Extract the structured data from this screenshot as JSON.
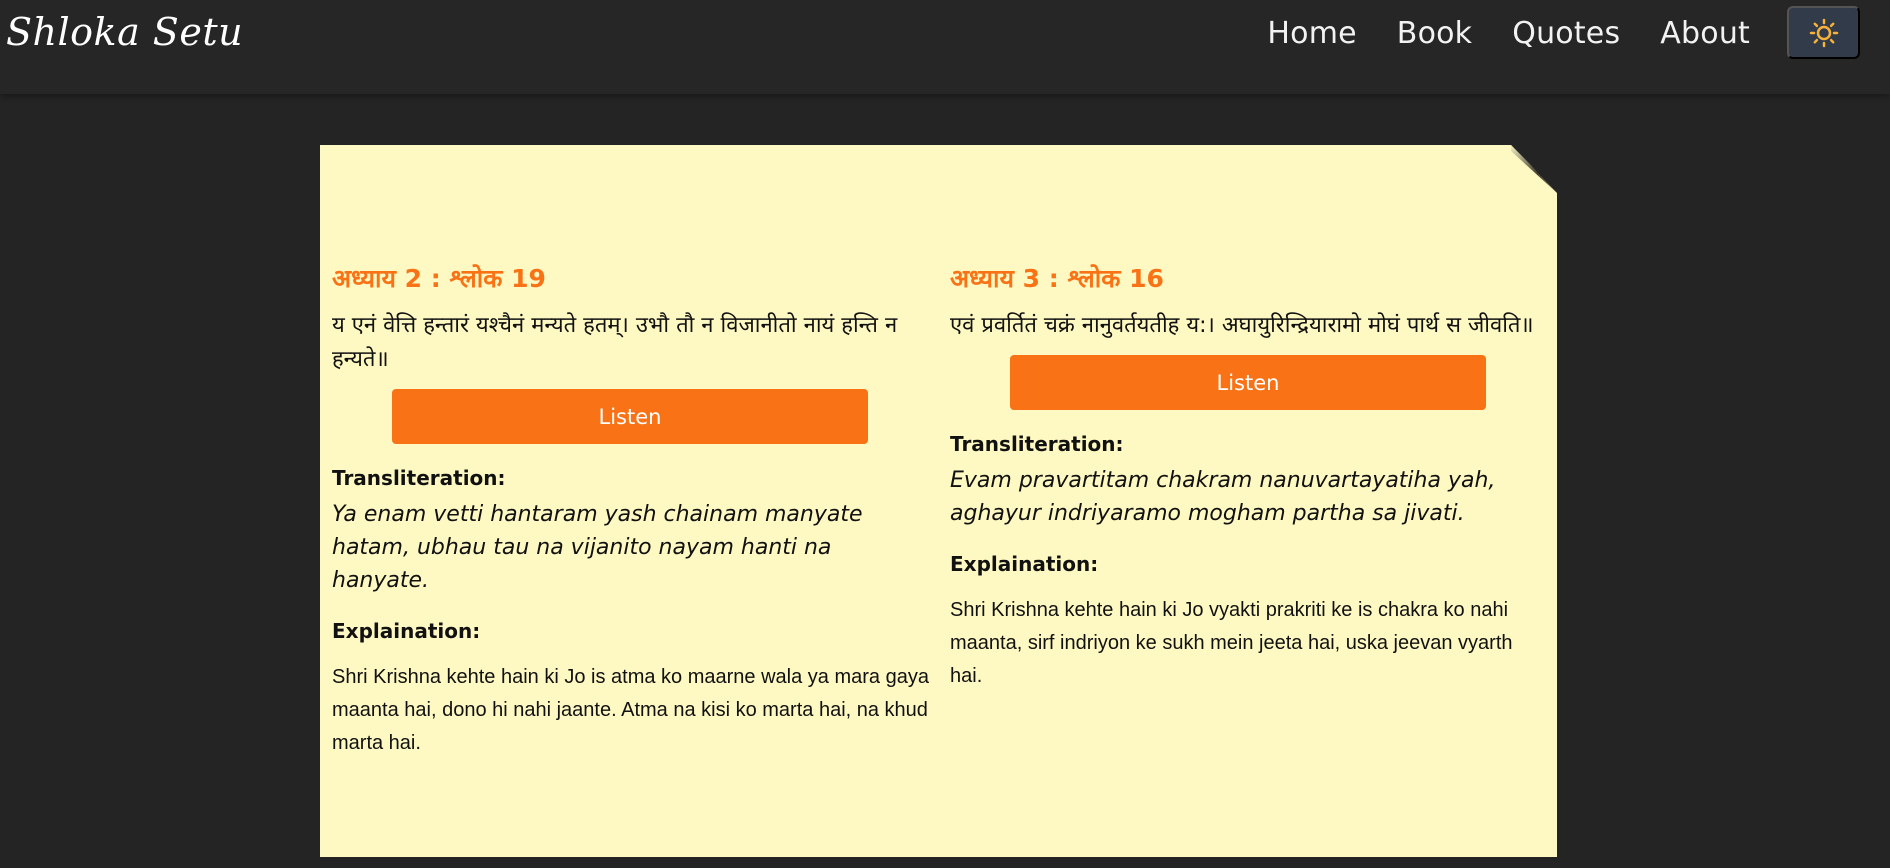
{
  "brand": "Shloka Setu",
  "nav": [
    "Home",
    "Book",
    "Quotes",
    "About"
  ],
  "theme_toggle_icon": "sun-icon",
  "colors": {
    "accent": "#f97316",
    "card_bg": "#fef9c3",
    "page_bg": "#242424"
  },
  "verses": [
    {
      "title": "अध्याय 2 : श्लोक 19",
      "sanskrit": "य एनं वेत्ति हन्तारं यश्चैनं मन्यते हतम्। उभौ तौ न विजानीतो नायं हन्ति न हन्यते॥",
      "listen_label": "Listen",
      "translit_label": "Transliteration:",
      "translit": "Ya enam vetti hantaram yash chainam manyate hatam, ubhau tau na vijanito nayam hanti na hanyate.",
      "explain_label": "Explaination:",
      "explain": "Shri Krishna kehte hain ki Jo is atma ko maarne wala ya mara gaya maanta hai, dono hi nahi jaante. Atma na kisi ko marta hai, na khud marta hai."
    },
    {
      "title": "अध्याय 3 : श्लोक 16",
      "sanskrit": "एवं प्रवर्तितं चक्रं नानुवर्तयतीह य:। अघायुरिन्द्रियारामो मोघं पार्थ स जीवति॥",
      "listen_label": "Listen",
      "translit_label": "Transliteration:",
      "translit": "Evam pravartitam chakram nanuvartayatiha yah, aghayur indriyaramo mogham partha sa jivati.",
      "explain_label": "Explaination:",
      "explain": "Shri Krishna kehte hain ki Jo vyakti prakriti ke is chakra ko nahi maanta, sirf indriyon ke sukh mein jeeta hai, uska jeevan vyarth hai."
    }
  ]
}
